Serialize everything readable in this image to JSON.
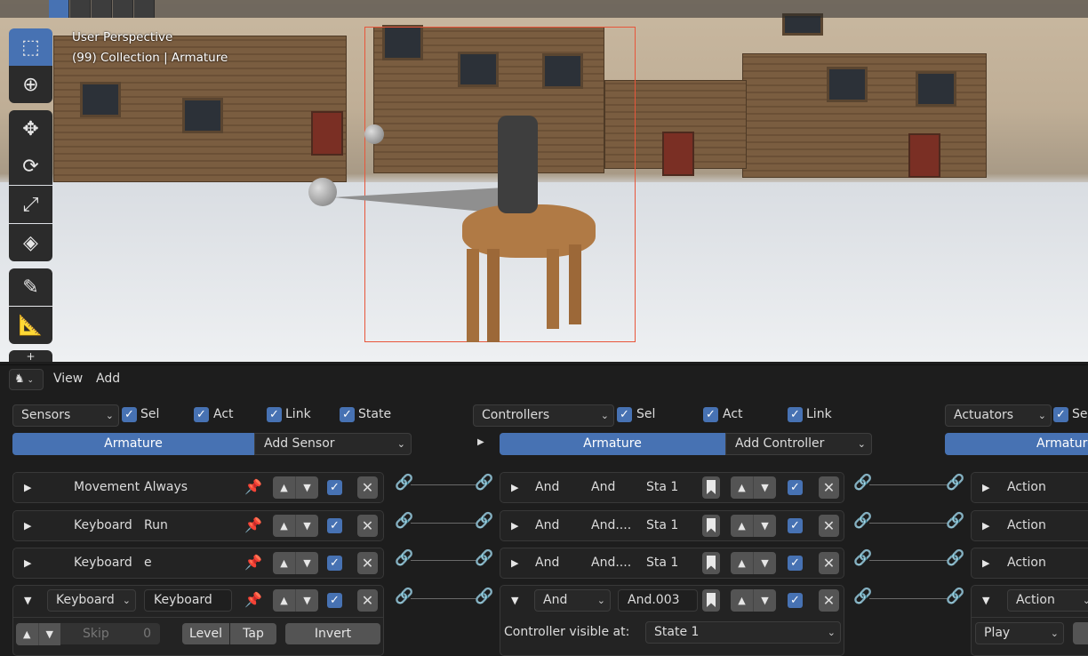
{
  "viewport": {
    "perspective": "User Perspective",
    "collection": "(99) Collection | Armature"
  },
  "header": {
    "editor_icon": "logic-bricks-icon",
    "menu": [
      "View",
      "Add"
    ]
  },
  "sensors": {
    "dropdown": "Sensors",
    "filters": [
      "Sel",
      "Act",
      "Link",
      "State"
    ],
    "object": "Armature",
    "add": "Add Sensor",
    "rows": [
      {
        "name": "Movement",
        "type": "Always"
      },
      {
        "name": "Keyboard",
        "type": "Run"
      },
      {
        "name": "Keyboard",
        "type": "e"
      },
      {
        "type": "Keyboard",
        "name": "Keyboard",
        "expanded": true
      }
    ],
    "expanded_row": {
      "skip_label": "Skip",
      "skip_value": "0",
      "level": "Level",
      "tap": "Tap",
      "invert": "Invert"
    }
  },
  "controllers": {
    "dropdown": "Controllers",
    "filters": [
      "Sel",
      "Act",
      "Link"
    ],
    "object": "Armature",
    "add": "Add Controller",
    "rows": [
      {
        "type": "And",
        "name": "And",
        "state": "Sta 1"
      },
      {
        "type": "And",
        "name": "And....",
        "state": "Sta 1"
      },
      {
        "type": "And",
        "name": "And....",
        "state": "Sta 1"
      },
      {
        "type": "And",
        "name": "And.003",
        "expanded": true
      }
    ],
    "visible_label": "Controller visible at:",
    "visible_value": "State 1"
  },
  "actuators": {
    "dropdown": "Actuators",
    "filters": [
      "Sel"
    ],
    "object": "Armature",
    "rows": [
      {
        "type": "Action"
      },
      {
        "type": "Action"
      },
      {
        "type": "Action"
      },
      {
        "type": "Action",
        "expanded": true
      }
    ],
    "play_mode": "Play"
  },
  "colors": {
    "accent": "#4772b3",
    "panel": "#232323",
    "background": "#1d1d1d"
  }
}
